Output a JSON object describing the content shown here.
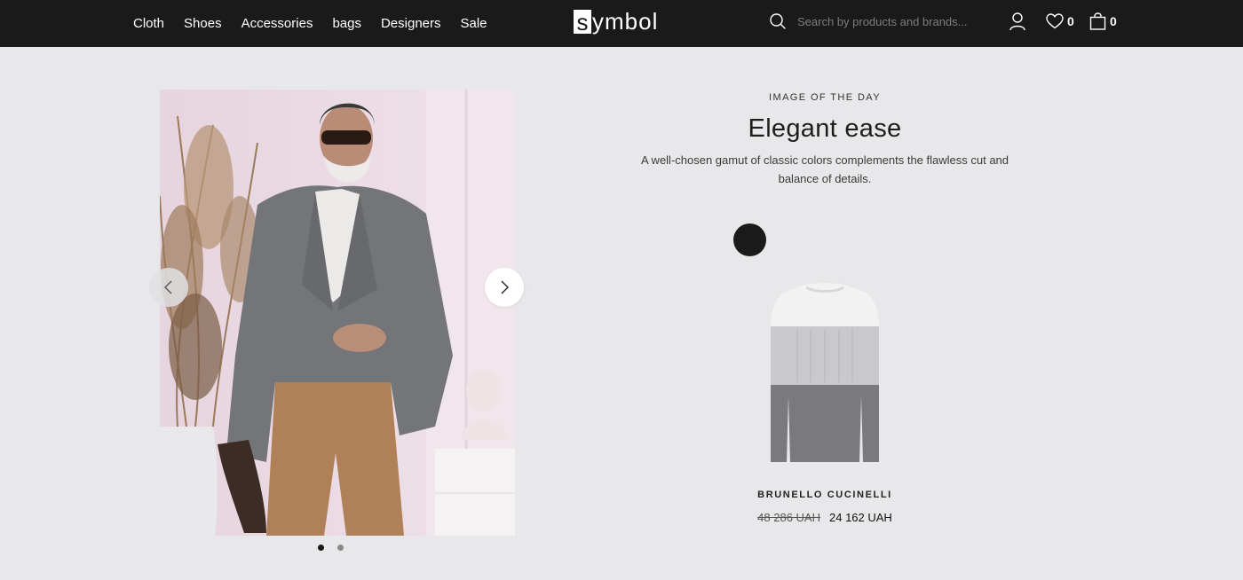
{
  "nav": {
    "items": [
      {
        "label": "Cloth"
      },
      {
        "label": "Shoes"
      },
      {
        "label": "Accessories"
      },
      {
        "label": "bags"
      },
      {
        "label": "Designers"
      },
      {
        "label": "Sale"
      }
    ]
  },
  "logo": {
    "box_letter": "s",
    "rest": "ymbol"
  },
  "search": {
    "placeholder": "Search by products and brands..."
  },
  "header": {
    "wishlist_count": "0",
    "cart_count": "0"
  },
  "hero": {
    "eyebrow": "IMAGE OF THE DAY",
    "title": "Elegant ease",
    "description": "A well-chosen gamut of classic colors complements the flawless cut and balance of details."
  },
  "product": {
    "brand": "BRUNELLO CUCINELLI",
    "old_price": "48 286 UAH",
    "price": "24 162 UAH"
  },
  "carousel": {
    "slides": 2,
    "active": 1
  },
  "colors": {
    "header_bg": "#1a1a1a",
    "page_bg": "#e8e7ea"
  }
}
